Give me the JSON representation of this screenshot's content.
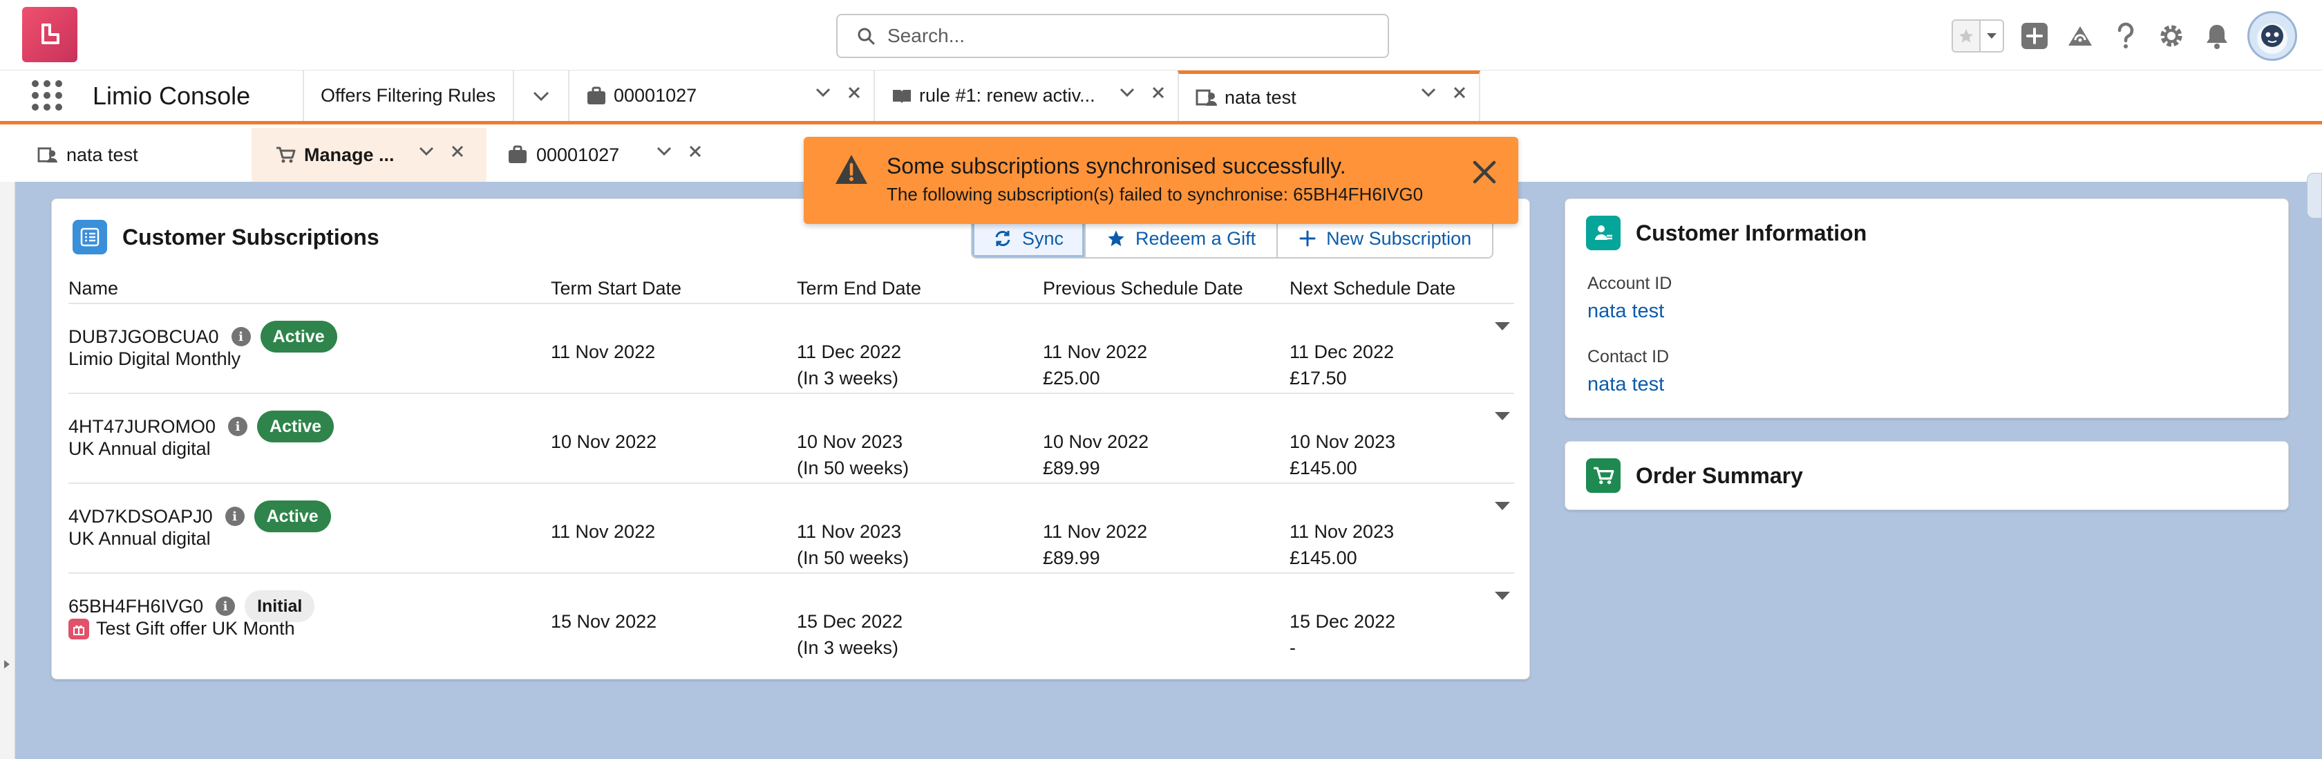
{
  "search": {
    "placeholder": "Search..."
  },
  "app": {
    "name": "Limio Console"
  },
  "nav_tabs": [
    {
      "label": "Offers Filtering Rules"
    },
    {
      "label": "00001027"
    },
    {
      "label": "rule #1: renew activ..."
    },
    {
      "label": "nata test"
    }
  ],
  "sub_tabs": [
    {
      "label": "nata test"
    },
    {
      "label": "Manage ..."
    },
    {
      "label": "00001027"
    }
  ],
  "toast": {
    "title": "Some subscriptions synchronised successfully.",
    "message": "The following subscription(s) failed to synchronise: 65BH4FH6IVG0",
    "color": "#fe9339"
  },
  "subscriptions_card": {
    "title": "Customer Subscriptions",
    "buttons": {
      "sync": "Sync",
      "redeem": "Redeem a Gift",
      "new": "New Subscription"
    },
    "columns": [
      "Name",
      "Term Start Date",
      "Term End Date",
      "Previous Schedule Date",
      "Next Schedule Date"
    ],
    "rows": [
      {
        "id": "DUB7JGOBCUA0",
        "status": "Active",
        "product": "Limio Digital Monthly",
        "term_start": "11 Nov 2022",
        "term_end": "11 Dec 2022",
        "term_end_note": "(In 3 weeks)",
        "prev_date": "11 Nov 2022",
        "prev_amount": "£25.00",
        "next_date": "11 Dec 2022",
        "next_amount": "£17.50"
      },
      {
        "id": "4HT47JUROMO0",
        "status": "Active",
        "product": "UK Annual digital",
        "term_start": "10 Nov 2022",
        "term_end": "10 Nov 2023",
        "term_end_note": "(In 50 weeks)",
        "prev_date": "10 Nov 2022",
        "prev_amount": "£89.99",
        "next_date": "10 Nov 2023",
        "next_amount": "£145.00"
      },
      {
        "id": "4VD7KDSOAPJ0",
        "status": "Active",
        "product": "UK Annual digital",
        "term_start": "11 Nov 2022",
        "term_end": "11 Nov 2023",
        "term_end_note": "(In 50 weeks)",
        "prev_date": "11 Nov 2022",
        "prev_amount": "£89.99",
        "next_date": "11 Nov 2023",
        "next_amount": "£145.00"
      },
      {
        "id": "65BH4FH6IVG0",
        "status": "Initial",
        "product": "Test Gift offer UK Month",
        "term_start": "15 Nov 2022",
        "term_end": "15 Dec 2022",
        "term_end_note": "(In 3 weeks)",
        "prev_date": "",
        "prev_amount": "",
        "next_date": "15 Dec 2022",
        "next_amount": "-"
      }
    ]
  },
  "customer_info": {
    "title": "Customer Information",
    "account_label": "Account ID",
    "account_value": "nata test",
    "contact_label": "Contact ID",
    "contact_value": "nata test"
  },
  "order_summary": {
    "title": "Order Summary"
  },
  "colors": {
    "brand_orange": "#f07a2d",
    "active_green": "#2e844a",
    "link_blue": "#0b5cab",
    "workspace_blue": "#b0c4df"
  }
}
